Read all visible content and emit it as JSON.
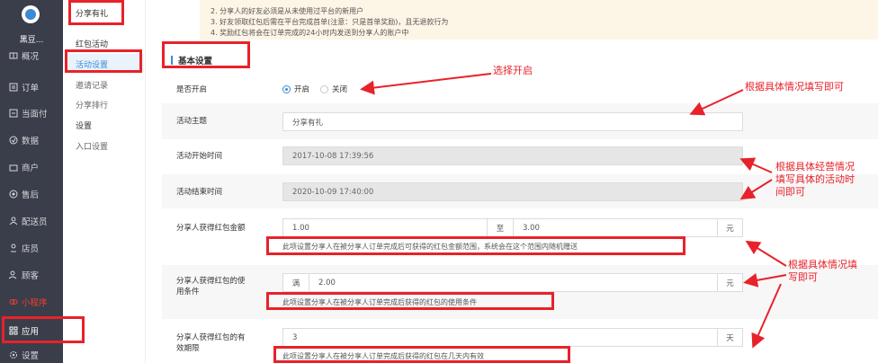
{
  "nav": {
    "store": "黑豆...",
    "items": [
      {
        "label": "概况",
        "icon": "overview-icon"
      },
      {
        "label": "订单",
        "icon": "order-icon"
      },
      {
        "label": "当面付",
        "icon": "face-pay-icon"
      },
      {
        "label": "数据",
        "icon": "data-icon"
      },
      {
        "label": "商户",
        "icon": "merchant-icon"
      },
      {
        "label": "售后",
        "icon": "after-sale-icon"
      },
      {
        "label": "配送员",
        "icon": "courier-icon"
      },
      {
        "label": "店员",
        "icon": "clerk-icon"
      },
      {
        "label": "顾客",
        "icon": "customer-icon"
      },
      {
        "label": "小程序",
        "icon": "miniprogram-icon"
      },
      {
        "label": "应用",
        "icon": "apps-icon"
      },
      {
        "label": "设置",
        "icon": "settings-icon"
      }
    ]
  },
  "submenu": {
    "title": "分享有礼",
    "group1": "红包活动",
    "links1": [
      "活动设置",
      "邀请记录",
      "分享排行"
    ],
    "group2": "设置",
    "links2": [
      "入口设置"
    ]
  },
  "notice": {
    "lines": [
      "2. 分享人的好友必须是从未使用过平台的新用户",
      "3. 好友领取红包后需在平台完成首单(注意：只是首单奖励)，且无退款行为",
      "4. 奖励红包将会在订单完成的24小时内发送到分享人的账户中"
    ]
  },
  "form": {
    "section_title": "基本设置",
    "enable_label": "是否开启",
    "enable_on": "开启",
    "enable_off": "关闭",
    "theme_label": "活动主题",
    "theme_value": "分享有礼",
    "start_label": "活动开始时间",
    "start_value": "2017-10-08 17:39:56",
    "end_label": "活动结束时间",
    "end_value": "2020-10-09 17:40:00",
    "amount_label": "分享人获得红包金额",
    "amount_min": "1.00",
    "amount_to": "至",
    "amount_max": "3.00",
    "amount_unit": "元",
    "amount_help": "此项设置分享人在被分享人订单完成后可获得的红包金额范围，系统会在这个范围内随机赠送",
    "cond_label_1": "分享人获得红包的使",
    "cond_label_2": "用条件",
    "cond_prefix": "满",
    "cond_value": "2.00",
    "cond_unit": "元",
    "cond_help": "此项设置分享人在被分享人订单完成后获得的红包的使用条件",
    "valid_label_1": "分享人获得红包的有",
    "valid_label_2": "效期限",
    "valid_value": "3",
    "valid_unit": "天",
    "valid_help": "此项设置分享人在被分享人订单完成后获得的红包在几天内有效"
  },
  "annotations": {
    "select_on": "选择开启",
    "fill_1": "根据具体情况填写即可",
    "fill_time_1": "根据具体经营情况",
    "fill_time_2": "填写具体的活动时",
    "fill_time_3": "间即可",
    "fill_2_1": "根据具体情况填",
    "fill_2_2": "写即可"
  },
  "colors": {
    "accent": "#3b8ad8",
    "annotation": "#e8222a",
    "nav_bg": "#3a3d4a"
  }
}
